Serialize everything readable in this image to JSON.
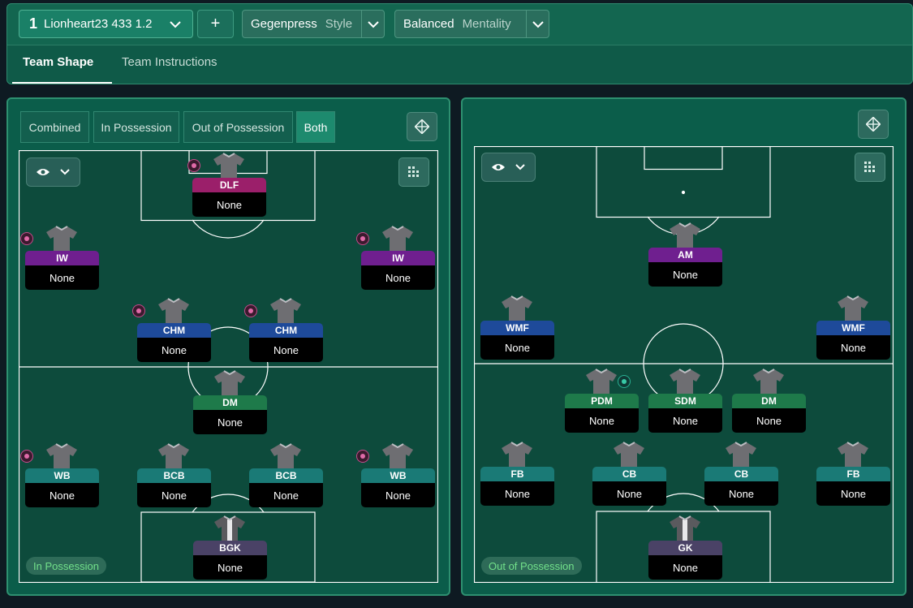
{
  "header": {
    "tactic_number": "1",
    "tactic_name": "Lionheart23 433 1.2",
    "add_label": "+",
    "style_value": "Gegenpress",
    "style_label": "Style",
    "mentality_value": "Balanced",
    "mentality_label": "Mentality"
  },
  "tabs": {
    "team_shape": "Team Shape",
    "team_instructions": "Team Instructions"
  },
  "view_toggle": {
    "combined": "Combined",
    "in_possession": "In Possession",
    "out_of_possession": "Out of Possession",
    "both": "Both",
    "selected": "Both"
  },
  "left_pitch": {
    "label": "In Possession",
    "players": [
      {
        "role": "DLF",
        "duty": "None"
      },
      {
        "role": "IW",
        "duty": "None"
      },
      {
        "role": "IW",
        "duty": "None"
      },
      {
        "role": "CHM",
        "duty": "None"
      },
      {
        "role": "CHM",
        "duty": "None"
      },
      {
        "role": "DM",
        "duty": "None"
      },
      {
        "role": "WB",
        "duty": "None"
      },
      {
        "role": "BCB",
        "duty": "None"
      },
      {
        "role": "BCB",
        "duty": "None"
      },
      {
        "role": "WB",
        "duty": "None"
      },
      {
        "role": "BGK",
        "duty": "None"
      }
    ]
  },
  "right_pitch": {
    "label": "Out of Possession",
    "players": [
      {
        "role": "AM",
        "duty": "None"
      },
      {
        "role": "WMF",
        "duty": "None"
      },
      {
        "role": "WMF",
        "duty": "None"
      },
      {
        "role": "PDM",
        "duty": "None"
      },
      {
        "role": "SDM",
        "duty": "None"
      },
      {
        "role": "DM",
        "duty": "None"
      },
      {
        "role": "FB",
        "duty": "None"
      },
      {
        "role": "CB",
        "duty": "None"
      },
      {
        "role": "CB",
        "duty": "None"
      },
      {
        "role": "FB",
        "duty": "None"
      },
      {
        "role": "GK",
        "duty": "None"
      }
    ]
  },
  "icons": {
    "dropdown": "chevron-down-icon",
    "view": "eye-icon",
    "grid": "grid-icon",
    "pitch_tools": "pitch-tools-icon",
    "instruction": "instruction-badge-icon",
    "shirt": "shirt-icon"
  },
  "colors": {
    "accent": "#1d8a6e",
    "attack": "#9b1f6a",
    "wing": "#6f1f8f",
    "midfield": "#1e4a9a",
    "defensive_mid": "#1e7a4a",
    "defence": "#1a7a76",
    "goalkeeper": "#4a4266",
    "possession_label": "#72e08a"
  }
}
